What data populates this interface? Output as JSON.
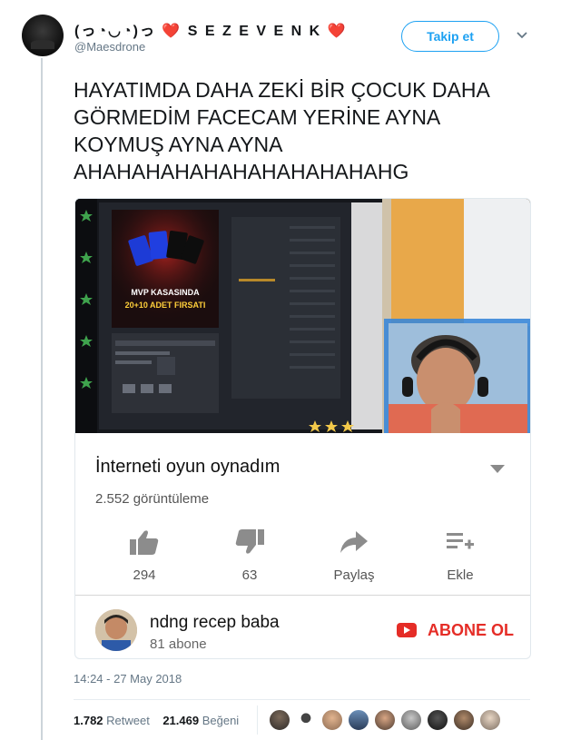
{
  "author": {
    "display_name": "(っ◔◡◔)っ ❤️ S E Z E V E N K ❤️",
    "handle": "@Maesdrone"
  },
  "follow_label": "Takip et",
  "tweet_text": "HAYATIMDA DAHA ZEKİ BİR ÇOCUK DAHA GÖRMEDİM FACECAM YERİNE AYNA KOYMUŞ AYNA AYNA AHAHAHAHAHAHAHAHAHAHAHG",
  "video_card": {
    "thumbnail_text": {
      "promo_line1": "MVP KASASINDA",
      "promo_line2": "20+10 ADET FIRSATI"
    },
    "title": "İnterneti oyun oynadım",
    "views": "2.552 görüntüleme",
    "actions": [
      {
        "icon": "thumbs-up-icon",
        "label": "294"
      },
      {
        "icon": "thumbs-down-icon",
        "label": "63"
      },
      {
        "icon": "share-icon",
        "label": "Paylaş"
      },
      {
        "icon": "add-to-playlist-icon",
        "label": "Ekle"
      }
    ],
    "channel": {
      "name": "ndng recep baba",
      "subscribers": "81 abone",
      "subscribe_label": "ABONE OL"
    }
  },
  "timestamp": "14:24 - 27 May 2018",
  "stats": {
    "retweets": "1.782",
    "retweets_label": "Retweet",
    "likes": "21.469",
    "likes_label": "Beğeni"
  },
  "colors": {
    "twitter_blue": "#1da1f2",
    "youtube_red": "#e52d27",
    "heart_red": "#e0245e"
  }
}
